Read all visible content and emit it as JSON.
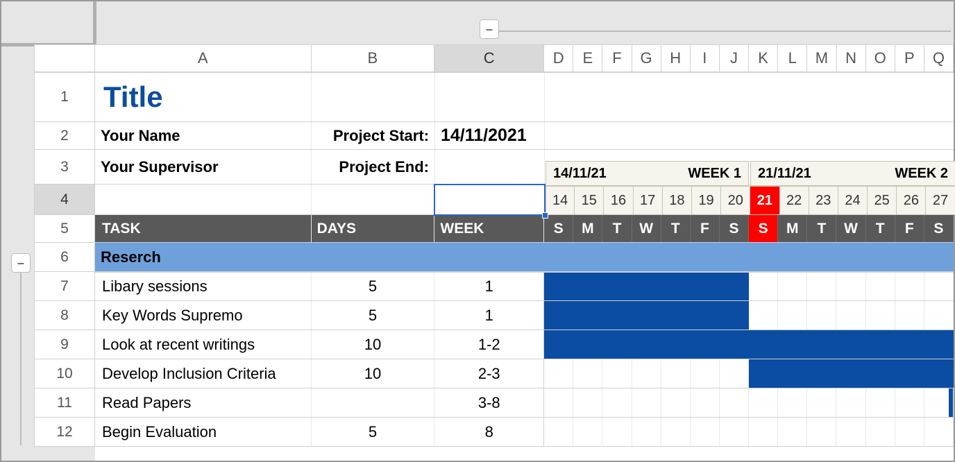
{
  "outline": {
    "collapse_v": "–",
    "collapse_h": "–"
  },
  "columns": [
    "A",
    "B",
    "C",
    "D",
    "E",
    "F",
    "G",
    "H",
    "I",
    "J",
    "K",
    "L",
    "M",
    "N",
    "O",
    "P",
    "Q"
  ],
  "row_numbers": [
    1,
    2,
    3,
    4,
    5,
    6,
    7,
    8,
    9,
    10,
    11,
    12
  ],
  "selected_col": "C",
  "selected_row": 4,
  "title": "Title",
  "meta": {
    "name_label": "Your Name",
    "supervisor_label": "Your Supervisor",
    "start_label": "Project Start:",
    "end_label": "Project End:",
    "start_date": "14/11/2021",
    "end_date": ""
  },
  "weeks": [
    {
      "start": "14/11/21",
      "label": "WEEK 1",
      "days": [
        14,
        15,
        16,
        17,
        18,
        19,
        20
      ]
    },
    {
      "start": "21/11/21",
      "label": "WEEK 2",
      "days": [
        21,
        22,
        23,
        24,
        25,
        26,
        27
      ]
    }
  ],
  "today_day": 21,
  "headers": {
    "task": "TASK",
    "days": "DAYS",
    "week": "WEEK"
  },
  "dow": [
    "S",
    "M",
    "T",
    "W",
    "T",
    "F",
    "S",
    "S",
    "M",
    "T",
    "W",
    "T",
    "F",
    "S"
  ],
  "category": "Reserch",
  "tasks": [
    {
      "name": "Libary sessions",
      "days": "5",
      "week": "1",
      "gantt": [
        1,
        1,
        1,
        1,
        1,
        1,
        1,
        0,
        0,
        0,
        0,
        0,
        0,
        0
      ]
    },
    {
      "name": "Key Words Supremo",
      "days": "5",
      "week": "1",
      "gantt": [
        1,
        1,
        1,
        1,
        1,
        1,
        1,
        0,
        0,
        0,
        0,
        0,
        0,
        0
      ]
    },
    {
      "name": "Look at recent writings",
      "days": "10",
      "week": "1-2",
      "gantt": [
        1,
        1,
        1,
        1,
        1,
        1,
        1,
        1,
        1,
        1,
        1,
        1,
        1,
        1
      ]
    },
    {
      "name": "Develop Inclusion Criteria",
      "days": "10",
      "week": "2-3",
      "gantt": [
        0,
        0,
        0,
        0,
        0,
        0,
        0,
        1,
        1,
        1,
        1,
        1,
        1,
        1
      ]
    },
    {
      "name": "Read Papers",
      "days": "",
      "week": "3-8",
      "gantt": [
        0,
        0,
        0,
        0,
        0,
        0,
        0,
        0,
        0,
        0,
        0,
        0,
        0,
        2
      ]
    },
    {
      "name": "Begin Evaluation",
      "days": "5",
      "week": "8",
      "gantt": [
        0,
        0,
        0,
        0,
        0,
        0,
        0,
        0,
        0,
        0,
        0,
        0,
        0,
        0
      ]
    }
  ]
}
